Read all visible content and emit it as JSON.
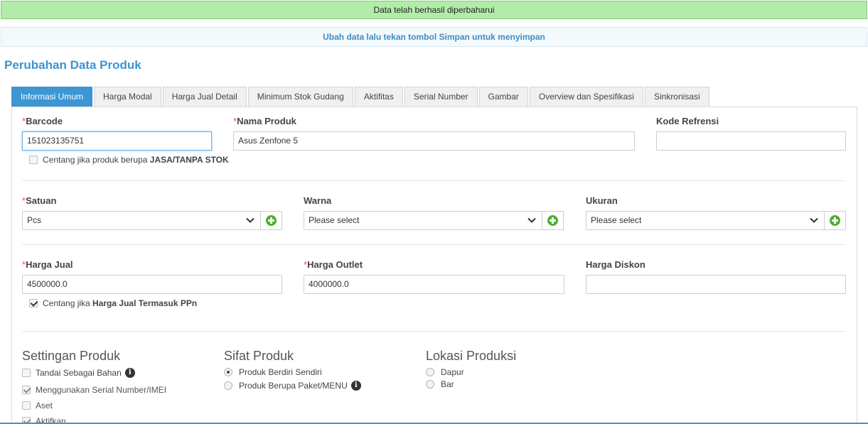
{
  "alerts": {
    "success": "Data telah berhasil diperbaharui",
    "info": "Ubah data lalu tekan tombol Simpan untuk menyimpan"
  },
  "page_title": "Perubahan Data Produk",
  "tabs": [
    {
      "label": "Informasi Umum",
      "active": true
    },
    {
      "label": "Harga Modal"
    },
    {
      "label": "Harga Jual Detail"
    },
    {
      "label": "Minimum Stok Gudang"
    },
    {
      "label": "Aktifitas"
    },
    {
      "label": "Serial Number"
    },
    {
      "label": "Gambar"
    },
    {
      "label": "Overview dan Spesifikasi"
    },
    {
      "label": "Sinkronisasi"
    }
  ],
  "form": {
    "required_mark": "*",
    "barcode": {
      "label": "Barcode",
      "value": "151023135751"
    },
    "nama_produk": {
      "label": "Nama Produk",
      "value": "Asus Zenfone 5"
    },
    "kode_refrensi": {
      "label": "Kode Refrensi",
      "value": ""
    },
    "jasa_check": {
      "prefix": "Centang jika produk berupa ",
      "strong": "JASA/TANPA STOK",
      "checked": false
    },
    "satuan": {
      "label": "Satuan",
      "value": "Pcs"
    },
    "warna": {
      "label": "Warna",
      "value": "Please select"
    },
    "ukuran": {
      "label": "Ukuran",
      "value": "Please select"
    },
    "harga_jual": {
      "label": "Harga Jual",
      "value": "4500000.0"
    },
    "harga_outlet": {
      "label": "Harga Outlet",
      "value": "4000000.0"
    },
    "harga_diskon": {
      "label": "Harga Diskon",
      "value": ""
    },
    "ppn_check": {
      "prefix": "Centang jika ",
      "strong": "Harga Jual Termasuk PPn",
      "checked": true
    }
  },
  "settingan": {
    "title": "Settingan Produk",
    "items": [
      {
        "label": "Tandai Sebagai Bahan",
        "checked": false
      },
      {
        "label": "Menggunakan Serial Number/IMEI",
        "checked": true
      },
      {
        "label": "Aset",
        "checked": false
      },
      {
        "label": "Aktifkan",
        "checked": true
      }
    ]
  },
  "sifat": {
    "title": "Sifat Produk",
    "options": [
      {
        "label": "Produk Berdiri Sendiri",
        "selected": true
      },
      {
        "label": "Produk Berupa Paket/MENU",
        "selected": false
      }
    ]
  },
  "lokasi": {
    "title": "Lokasi Produksi",
    "options": [
      {
        "label": "Dapur",
        "selected": false
      },
      {
        "label": "Bar",
        "selected": false
      }
    ]
  },
  "icons": {
    "info": "i"
  }
}
